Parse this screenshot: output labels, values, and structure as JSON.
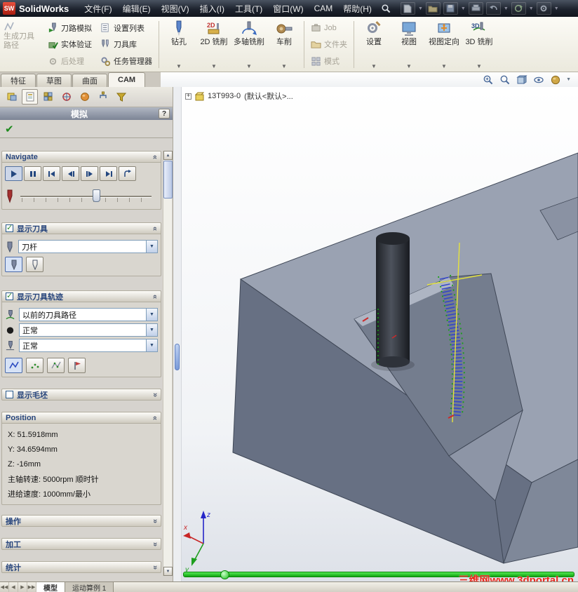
{
  "titlebar": {
    "logo_text": "SolidWorks",
    "menus": [
      "文件(F)",
      "编辑(E)",
      "视图(V)",
      "插入(I)",
      "工具(T)",
      "窗口(W)",
      "CAM",
      "帮助(H)"
    ]
  },
  "toolbar": {
    "generate_toolpath": "生成刀具路径",
    "sim_group": [
      "刀路模拟",
      "实体验证",
      "后处理"
    ],
    "manage_group": [
      "设置列表",
      "刀具库",
      "任务管理器"
    ],
    "machining_group": [
      "钻孔",
      "2D 铣削",
      "多轴铣削",
      "车削"
    ],
    "job_group": [
      "Job",
      "文件夹",
      "模式"
    ],
    "view_group": [
      "设置",
      "视图",
      "视图定向",
      "3D 铣削"
    ]
  },
  "tabs": [
    "特征",
    "草图",
    "曲面",
    "CAM"
  ],
  "panel": {
    "title": "模拟",
    "help": "?",
    "navigate": {
      "title": "Navigate"
    },
    "show_tool": {
      "title": "显示刀具",
      "value": "刀杆"
    },
    "show_toolpath": {
      "title": "显示刀具轨迹",
      "row1": "以前的刀具路径",
      "row2": "正常",
      "row3": "正常"
    },
    "show_stock": {
      "title": "显示毛坯"
    },
    "position": {
      "title": "Position",
      "x": "X: 51.5918mm",
      "y": "Y: 34.6594mm",
      "z": "Z: -16mm",
      "spindle": "主轴转速: 5000rpm 顺时针",
      "feed": "进给速度: 1000mm/最小"
    },
    "collapsed_sections": [
      "操作",
      "加工",
      "统计"
    ]
  },
  "viewport": {
    "tree_item": "13T993-0",
    "tree_config": "(默认<默认>...",
    "watermark": "三维网www.3dportal.cn",
    "triad": {
      "x": "x",
      "y": "y",
      "z": "z"
    }
  },
  "statusbar": {
    "tabs": [
      "模型",
      "运动算例 1"
    ]
  },
  "colors": {
    "progress_green": "#1fd41f",
    "watermark_red": "#e8281c",
    "part_top": "#9aa2b2",
    "part_front": "#677083",
    "part_right": "#7f8899"
  }
}
